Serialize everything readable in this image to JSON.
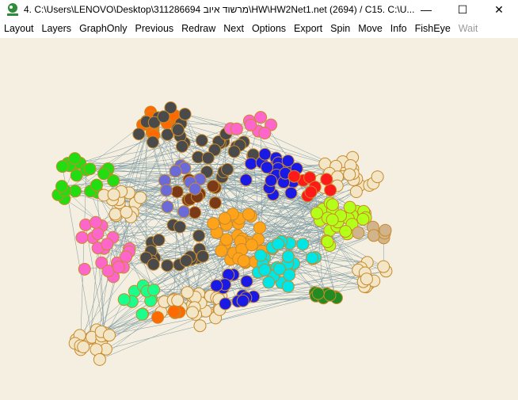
{
  "window": {
    "title": "4. C:\\Users\\LENOVO\\Desktop\\311286694 מרשוד איוב\\HW\\HW2Net1.net (2694) / C15. C:\\U...",
    "controls": {
      "minimize": "—",
      "maximize": "☐",
      "close": "✕"
    }
  },
  "menu": {
    "items": [
      {
        "label": "Layout",
        "enabled": true
      },
      {
        "label": "Layers",
        "enabled": true
      },
      {
        "label": "GraphOnly",
        "enabled": true
      },
      {
        "label": "Previous",
        "enabled": true
      },
      {
        "label": "Redraw",
        "enabled": true
      },
      {
        "label": "Next",
        "enabled": true
      },
      {
        "label": "Options",
        "enabled": true
      },
      {
        "label": "Export",
        "enabled": true
      },
      {
        "label": "Spin",
        "enabled": true
      },
      {
        "label": "Move",
        "enabled": true
      },
      {
        "label": "Info",
        "enabled": true
      },
      {
        "label": "FishEye",
        "enabled": true
      },
      {
        "label": "Wait",
        "enabled": false
      }
    ]
  },
  "colors": {
    "canvas_bg": "#f4efe0",
    "edge": "#7f9ba3",
    "node_stroke": "#c98a2a",
    "clusters": [
      "#22dd11",
      "#f2e6c6",
      "#4a4a4a",
      "#ff6a00",
      "#1a1ae6",
      "#00e6e6",
      "#b3ff1a",
      "#ffa31a",
      "#ff1a1a",
      "#1aff8c",
      "#ff66cc",
      "#228b22",
      "#d2b48c",
      "#7a3a1a",
      "#6a6ad9"
    ]
  }
}
